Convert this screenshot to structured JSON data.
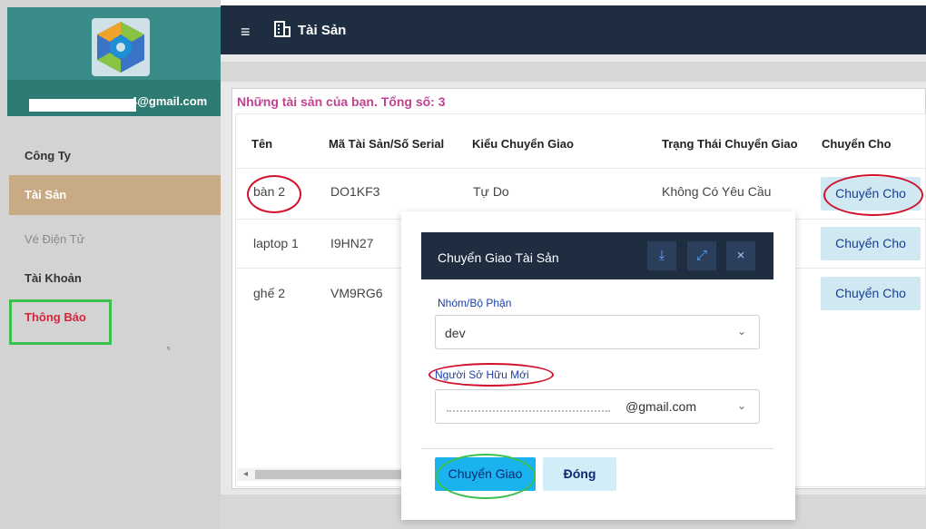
{
  "sidebar": {
    "email_suffix": "4@gmail.com",
    "items": [
      {
        "label": "Công Ty"
      },
      {
        "label": "Tài Sản"
      },
      {
        "label": "Vé Điện Tử"
      },
      {
        "label": "Tài Khoản"
      },
      {
        "label": "Thông Báo"
      }
    ],
    "tiny_mark": "ᵑ"
  },
  "topbar": {
    "menu_icon": "hamburger-icon",
    "title": "Tài Sản"
  },
  "main": {
    "title": "Những tài sản của bạn. Tổng số: 3",
    "columns": [
      "Tên",
      "Mã Tài Sản/Số Serial",
      "Kiểu Chuyển Giao",
      "Trạng Thái Chuyển Giao",
      "Chuyển Cho"
    ],
    "rows": [
      {
        "name": "bàn 2",
        "serial": "DO1KF3",
        "type": "Tự Do",
        "status": "Không Có Yêu Cầu",
        "action": "Chuyển Cho"
      },
      {
        "name": "laptop 1",
        "serial": "I9HN27",
        "type": "",
        "status": "",
        "action": "Chuyển Cho"
      },
      {
        "name": "ghế 2",
        "serial": "VM9RG6",
        "type": "",
        "status": "",
        "action": "Chuyển Cho"
      }
    ],
    "scroll_left": "◂"
  },
  "modal": {
    "title": "Chuyển Giao Tài Sản",
    "header_icons": [
      "download-icon",
      "external-link-icon",
      "close-icon"
    ],
    "download_glyph": "⤓",
    "expand_glyph": "⤢",
    "close_glyph": "×",
    "group_label": "Nhóm/Bộ Phận",
    "group_value": "dev",
    "owner_label": "Người Sở Hữu Mới",
    "owner_value_suffix": "@gmail.com",
    "chevron": "⌄",
    "submit_label": "Chuyển Giao",
    "close_label": "Đóng"
  },
  "colors": {
    "header_bg": "#1f2d41",
    "sidebar_teal": "#3a8c88",
    "active_nav": "#c8aa84",
    "title_pink": "#c2428f",
    "notify_red": "#d4263a",
    "button_light": "#cfe8f2",
    "button_primary": "#1ab3f0",
    "annotation_red": "#d1112c",
    "annotation_green": "#39c04d"
  }
}
